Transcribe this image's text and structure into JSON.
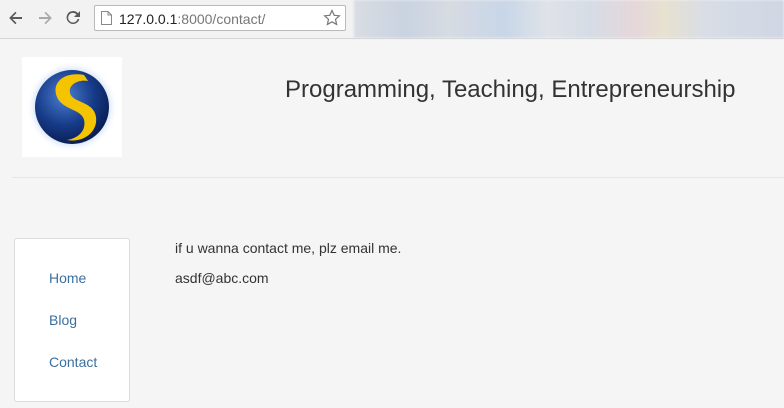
{
  "browser": {
    "url_host": "127.0.0.1",
    "url_path": ":8000/contact/"
  },
  "header": {
    "title": "Programming, Teaching, Entrepreneurship"
  },
  "sidebar": {
    "items": [
      {
        "label": "Home"
      },
      {
        "label": "Blog"
      },
      {
        "label": "Contact"
      }
    ]
  },
  "main": {
    "message": "if u wanna contact me, plz email me.",
    "email": "asdf@abc.com"
  },
  "colors": {
    "link": "#3b6fa0",
    "logo_blue": "#1a3f8f",
    "logo_yellow": "#f5c400"
  },
  "icons": [
    "back-arrow-icon",
    "forward-arrow-icon",
    "reload-icon",
    "page-icon",
    "bookmark-star-icon",
    "site-logo"
  ]
}
